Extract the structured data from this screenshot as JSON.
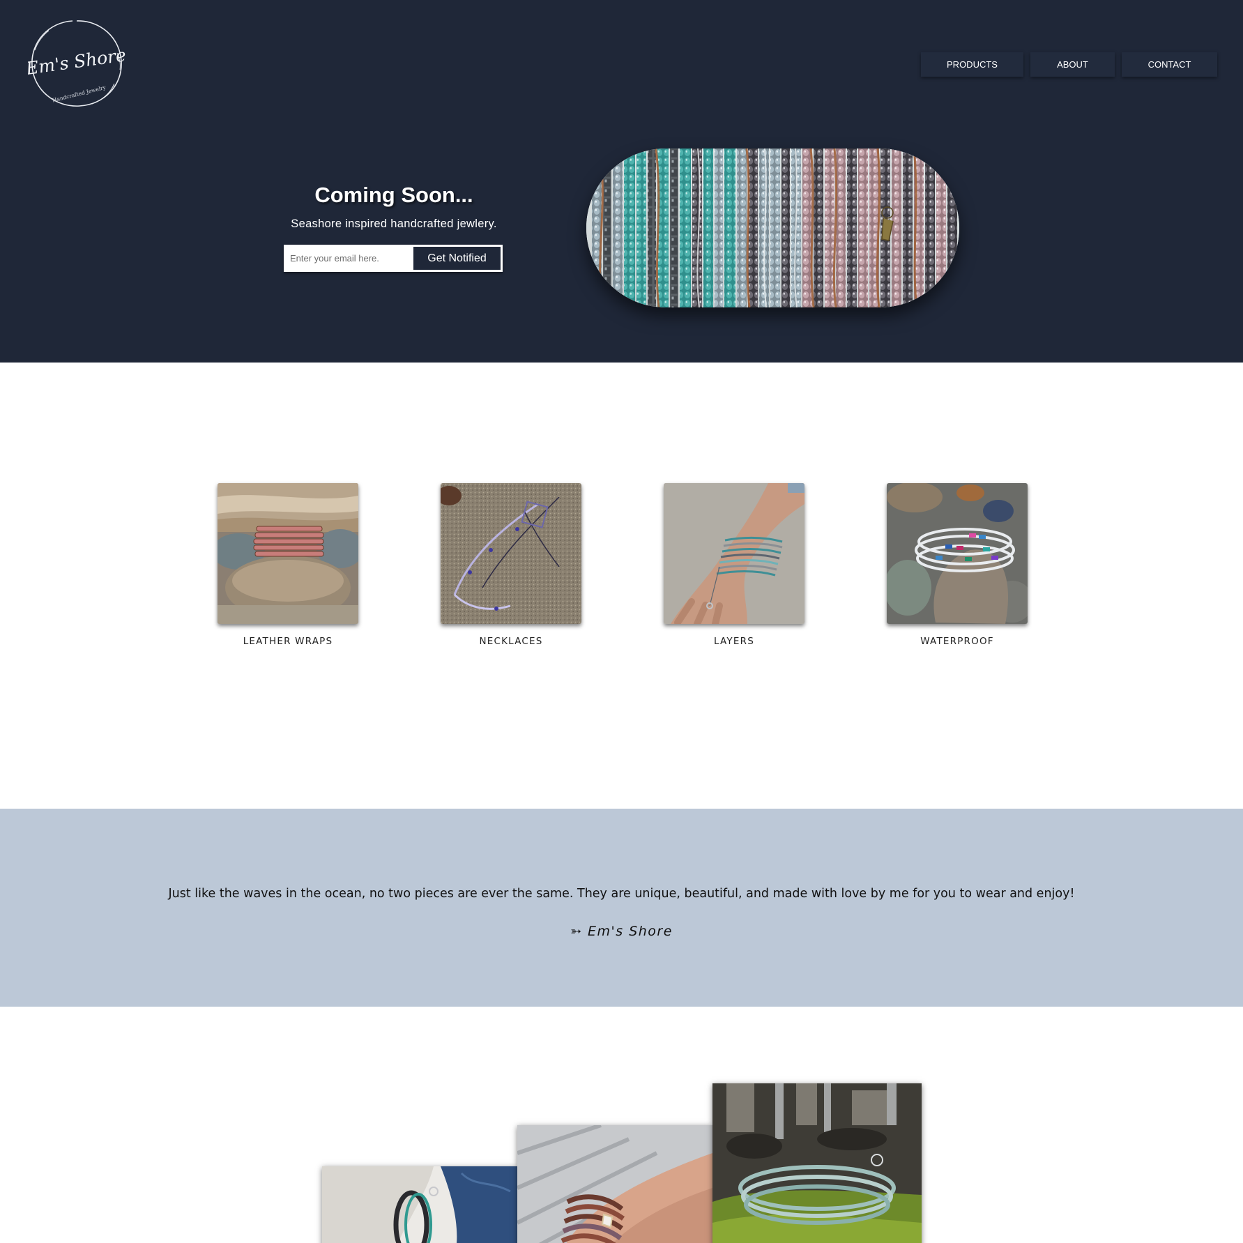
{
  "brand": {
    "logo_line1": "Em's Shore",
    "logo_line2": "Handcrafted Jewelry"
  },
  "nav": {
    "products": "PRODUCTS",
    "about": "ABOUT",
    "contact": "CONTACT"
  },
  "hero": {
    "title": "Coming Soon...",
    "subtitle": "Seashore inspired handcrafted jewlery.",
    "email_placeholder": "Enter your email here.",
    "notify_label": "Get Notified"
  },
  "categories": [
    {
      "label": "LEATHER WRAPS"
    },
    {
      "label": "NECKLACES"
    },
    {
      "label": "LAYERS"
    },
    {
      "label": "WATERPROOF"
    }
  ],
  "quote": {
    "text": "Just like the waves in the ocean, no two pieces are ever the same. They are unique, beautiful, and made with love by me for you to wear and enjoy!",
    "arrow": "➳",
    "signature": "Em's Shore"
  },
  "colors": {
    "hero_bg": "#1f2738",
    "quote_bg": "#bcc8d7",
    "page_bg": "#ffffff"
  }
}
